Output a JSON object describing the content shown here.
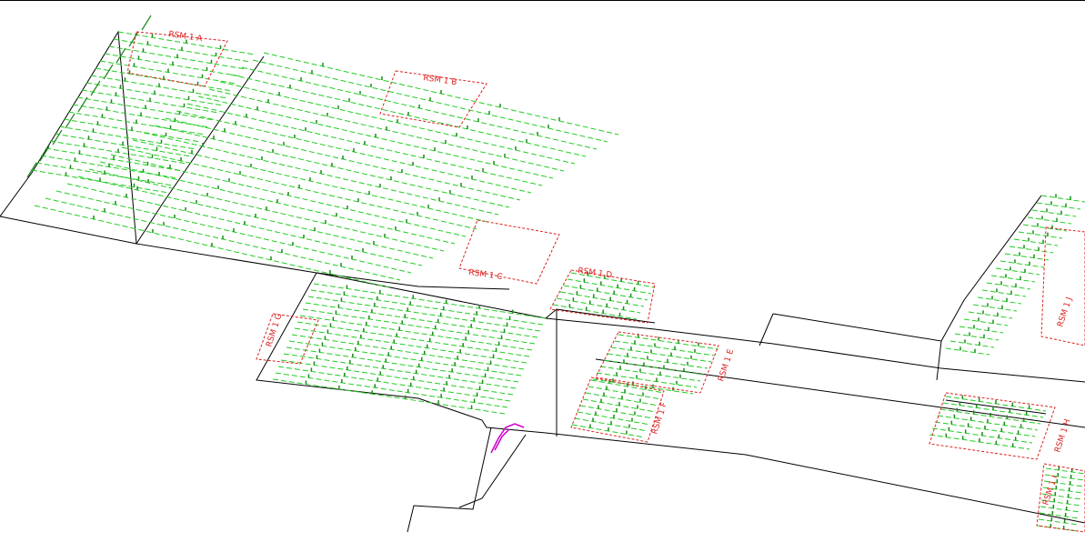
{
  "view": {
    "kind": "isometric CAD wireframe",
    "background": "#ffffff"
  },
  "colors": {
    "outline": "#000000",
    "pipe": "#22cc22",
    "sprinkler": "#1a8a1a",
    "zone_box": "#dd2222",
    "fitting": "#cc00cc"
  },
  "labels": {
    "zone_a": "RSM 1 A",
    "zone_b": "RSM 1 B",
    "zone_c": "RSM 1 C",
    "zone_d": "RSM 1 D",
    "zone_e": "RSM 1 E",
    "zone_f": "RSM 1 F",
    "zone_g": "RSM 1 G",
    "zone_h": "RSM 1 H",
    "zone_i": "RSM 1 I",
    "zone_j": "RSM 1 J"
  }
}
